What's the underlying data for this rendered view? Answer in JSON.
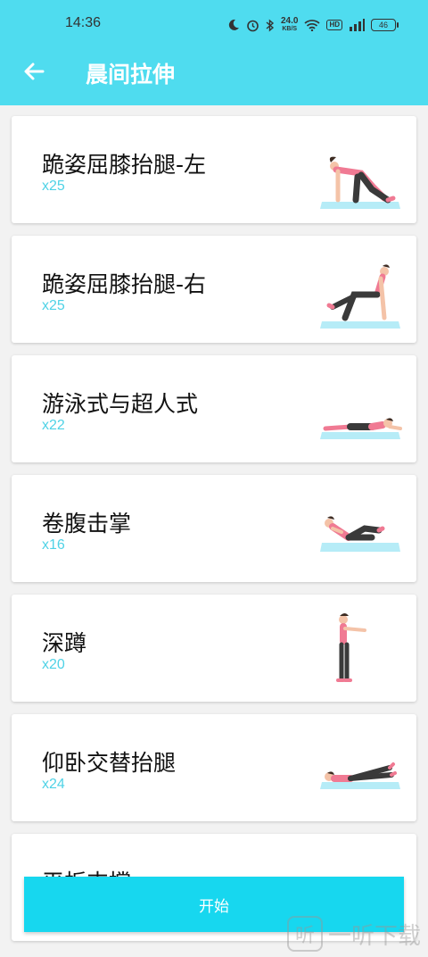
{
  "status_bar": {
    "time": "14:36",
    "net_speed": "24.0",
    "net_unit": "KB/S",
    "hd": "HD",
    "battery": "46"
  },
  "header": {
    "title": "晨间拉伸"
  },
  "exercises": [
    {
      "name": "跪姿屈膝抬腿-左",
      "reps": "x25"
    },
    {
      "name": "跪姿屈膝抬腿-右",
      "reps": "x25"
    },
    {
      "name": "游泳式与超人式",
      "reps": "x22"
    },
    {
      "name": "卷腹击掌",
      "reps": "x16"
    },
    {
      "name": "深蹲",
      "reps": "x20"
    },
    {
      "name": "仰卧交替抬腿",
      "reps": "x24"
    },
    {
      "name": "平板支撑",
      "reps": ""
    }
  ],
  "start_button": {
    "label": "开始"
  },
  "watermark": {
    "text": "一听下载"
  },
  "colors": {
    "accent": "#4fdcef",
    "button": "#17d7ef",
    "reps_text": "#4fd2e6",
    "mat": "#b6ecf7",
    "top_pink": "#f07a93",
    "pants": "#3a3a3a"
  }
}
